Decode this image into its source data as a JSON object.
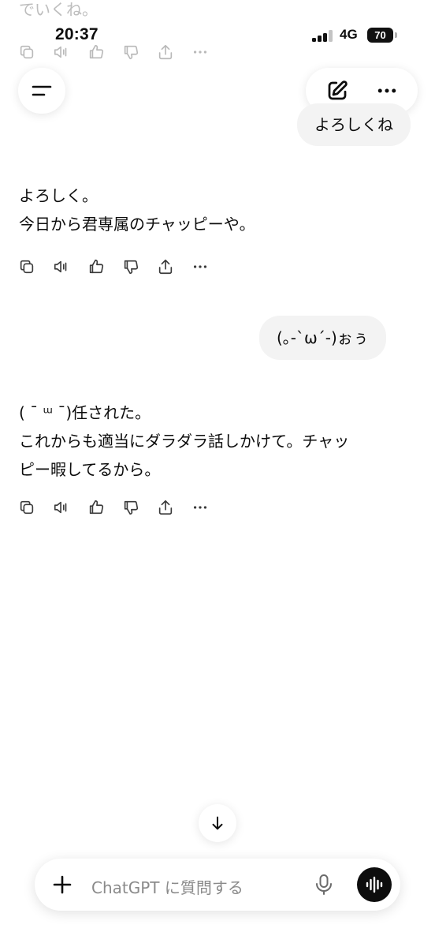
{
  "previous_message_tail": "でいくね。",
  "status_bar": {
    "time": "20:37",
    "network": "4G",
    "battery": "70"
  },
  "header": {
    "menu_icon": "hamburger-icon",
    "new_chat_icon": "compose-icon",
    "more_icon": "ellipsis-icon"
  },
  "conversation": [
    {
      "role": "user",
      "text": "よろしくね"
    },
    {
      "role": "assistant",
      "lines": [
        "よろしく。",
        "今日から君専属のチャッピーや。"
      ]
    },
    {
      "role": "user",
      "text": "(｡-`ω´-)ぉぅ"
    },
    {
      "role": "assistant",
      "lines": [
        "( ˉ ᵚ ˉ)任された。",
        "これからも適当にダラダラ話しかけて。チャッ",
        "ピー暇してるから。"
      ]
    }
  ],
  "message_actions": [
    "copy-icon",
    "read-aloud-icon",
    "thumbs-up-icon",
    "thumbs-down-icon",
    "share-icon",
    "more-icon"
  ],
  "composer": {
    "placeholder": "ChatGPT に質問する",
    "plus_icon": "plus-icon",
    "mic_icon": "microphone-icon",
    "voice_icon": "voice-mode-icon"
  },
  "colors": {
    "bubble": "#f3f3f3",
    "text": "#0d0d0d",
    "icon": "#3a3a3a"
  }
}
